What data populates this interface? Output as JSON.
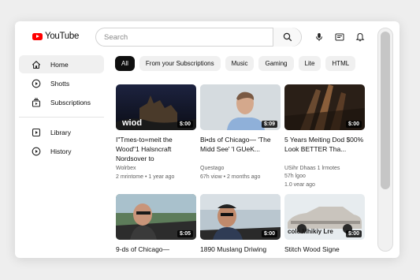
{
  "brand": {
    "logo_text": "YouTube",
    "accent": "#ff0000"
  },
  "search": {
    "placeholder": "Search"
  },
  "sidebar": {
    "items": [
      {
        "label": "Home",
        "icon": "home-icon"
      },
      {
        "label": "Shotts",
        "icon": "shorts-icon"
      },
      {
        "label": "Subscriptions",
        "icon": "subscriptions-icon"
      },
      {
        "label": "Library",
        "icon": "library-icon"
      },
      {
        "label": "History",
        "icon": "history-icon"
      }
    ]
  },
  "chips": [
    "All",
    "From your Subscriptions",
    "Music",
    "Gaming",
    "Lite",
    "HTML"
  ],
  "videos": [
    {
      "title": "I\"Tmes-to=meit the Wood\"1 Halsncraft Nordsover to",
      "channel": "Wolrbex",
      "meta": "2 mrintome • 1 year ago",
      "duration": "$:00"
    },
    {
      "title": "Bi•ds of Chicago— 'The Midd See' 'l GUeK...",
      "channel": "Questago",
      "meta": "67h viow • 2 months ago",
      "duration": "$:09"
    },
    {
      "title": "5 Years Meiting Dod $00% Look BETTER Tha...",
      "channel": "USihr Dhaas 1 lrmotes",
      "meta": "1.0 vear ago",
      "duration": "$:00",
      "meta2": "57h lgoo"
    },
    {
      "title": "9-ds of Chicago—",
      "channel": "",
      "meta": "",
      "duration": "$:05"
    },
    {
      "title": "1890 Muslang Driwing",
      "channel": "",
      "meta": "",
      "duration": "$:00"
    },
    {
      "title": "Stitch Wood Signe",
      "channel": "",
      "meta": "",
      "duration": "$:00"
    }
  ],
  "thumb_overlays": {
    "v1": "wiod",
    "v6": "cole Mhikiy Lre"
  }
}
